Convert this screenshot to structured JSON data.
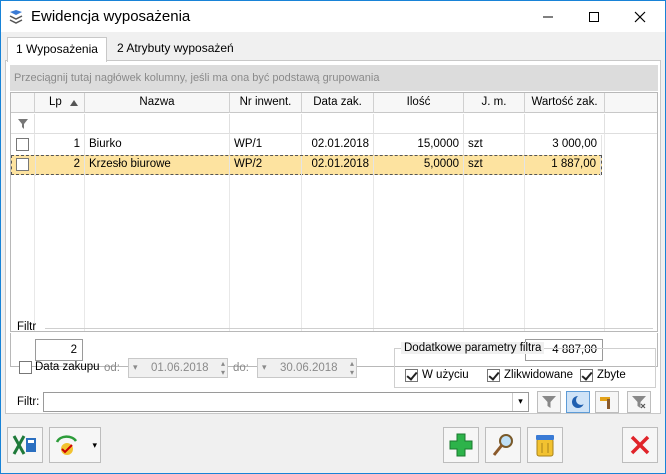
{
  "window": {
    "title": "Ewidencja wyposażenia"
  },
  "tabs": [
    {
      "label": "1 Wyposażenia",
      "active": true
    },
    {
      "label": "2 Atrybuty wyposażeń",
      "active": false
    }
  ],
  "grid": {
    "group_hint": "Przeciągnij tutaj nagłówek kolumny, jeśli ma ona być podstawą grupowania",
    "columns": [
      "Lp",
      "Nazwa",
      "Nr inwent.",
      "Data zak.",
      "Ilość",
      "J. m.",
      "Wartość zak."
    ],
    "rows": [
      {
        "lp": "1",
        "nazwa": "Biurko",
        "nr": "WP/1",
        "data": "02.01.2018",
        "ilosc": "15,0000",
        "jm": "szt",
        "wartosc": "3 000,00"
      },
      {
        "lp": "2",
        "nazwa": "Krzesło biurowe",
        "nr": "WP/2",
        "data": "02.01.2018",
        "ilosc": "5,0000",
        "jm": "szt",
        "wartosc": "1 887,00"
      }
    ],
    "footer": {
      "count": "2",
      "total": "4 887,00"
    }
  },
  "filter": {
    "section_label": "Filtr",
    "date_checkbox_label": "Data zakupu",
    "from_label": "od:",
    "from_value": "01.06.2018",
    "to_label": "do:",
    "to_value": "30.06.2018",
    "extra_label": "Dodatkowe parametry filtra",
    "opt_in_use": "W użyciu",
    "opt_liquidated": "Zlikwidowane",
    "opt_sold": "Zbyte",
    "text_label": "Filtr:",
    "text_value": ""
  },
  "colors": {
    "selected_row": "#fde3a0",
    "delete_red": "#e0242a",
    "add_green": "#2db34a"
  }
}
